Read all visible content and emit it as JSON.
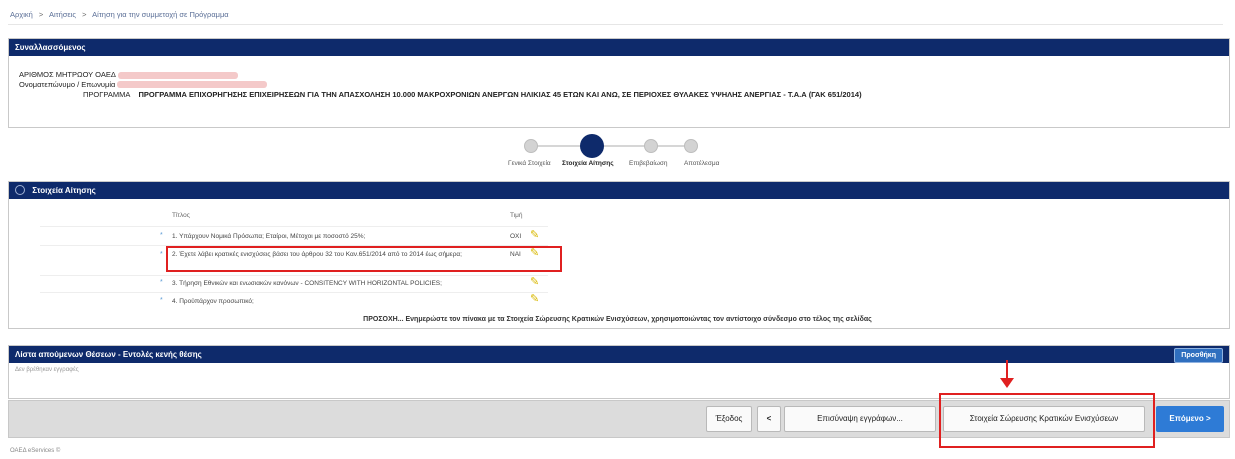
{
  "breadcrumb": {
    "home": "Αρχική",
    "sep": ">",
    "applications": "Αιτήσεις",
    "current": "Αίτηση για την συμμετοχή σε Πρόγραμμα"
  },
  "transactor": {
    "title": "Συναλλασσόμενος",
    "registry_label": "ΑΡΙΘΜΟΣ ΜΗΤΡΩΟΥ ΟΑΕΔ",
    "name_label": "Ονοματεπώνυμο / Επωνυμία",
    "program_label": "ΠΡΟΓΡΑΜΜΑ",
    "program_value": "ΠΡΟΓΡΑΜΜΑ ΕΠΙΧΟΡΗΓΗΣΗΣ ΕΠΙΧΕΙΡΗΣΕΩΝ ΓΙΑ ΤΗΝ ΑΠΑΣΧΟΛΗΣΗ 10.000 ΜΑΚΡΟΧΡΟΝΙΩΝ ΑΝΕΡΓΩΝ ΗΛΙΚΙΑΣ 45 ΕΤΩΝ ΚΑΙ ΑΝΩ, ΣΕ ΠΕΡΙΟΧΕΣ ΘΥΛΑΚΕΣ ΥΨΗΛΗΣ ΑΝΕΡΓΙΑΣ - Τ.Α.Α (ΓΑΚ 651/2014)"
  },
  "wizard": {
    "steps": [
      "Γενικά Στοιχεία",
      "Στοιχεία Αίτησης",
      "Επιβεβαίωση",
      "Αποτέλεσμα"
    ],
    "active_step": 2
  },
  "application": {
    "title": "Στοιχεία Αίτησης",
    "col_title": "Τίτλος",
    "col_value": "Τιμή",
    "rows": [
      {
        "star": "*",
        "text": "1. Υπάρχουν Νομικά Πρόσωπα; Εταίροι, Μέτοχοι με ποσοστό 25%;",
        "value": "ΟΧΙ"
      },
      {
        "star": "*",
        "text": "2. Έχετε λάβει κρατικές ενισχύσεις βάσει του άρθρου 32 του Καν.651/2014 από το 2014 έως σήμερα;",
        "value": "ΝΑΙ"
      },
      {
        "star": "*",
        "text": "3. Τήρηση Εθνικών και ενωσιακών κανόνων - CONSITENCY WITH HORIZONTAL POLICIES;",
        "value": ""
      },
      {
        "star": "*",
        "text": "4. Προϋπάρχον προσωπικό;",
        "value": ""
      }
    ],
    "warning": "ΠΡΟΣΟΧΗ... Ενημερώστε τον πίνακα με τα Στοιχεία Σώρευσης Κρατικών Ενισχύσεων, χρησιμοποιώντας τον αντίστοιχο σύνδεσμο στο τέλος της σελίδας"
  },
  "positions": {
    "title": "Λίστα απούμενων Θέσεων - Εντολές κενής θέσης",
    "add_label": "Προσθήκη",
    "empty_text": "Δεν βρέθηκαν εγγραφές"
  },
  "footer": {
    "exit_label": "Έξοδος",
    "back_label": "<",
    "attach_label": "Επισύναψη εγγράφων...",
    "state_aid_label": "Στοιχεία Σώρευσης Κρατικών Ενισχύσεων",
    "next_label": "Επόμενο",
    "next_chevron": ">",
    "bottom_text": "ΟΑΕΔ eServices ©"
  },
  "colors": {
    "header": "#0e2a6b",
    "highlight": "#e02020",
    "primary": "#2e7bd6"
  },
  "icons": {
    "edit": "pencil-icon",
    "collapse": "chevron-circle-icon"
  }
}
